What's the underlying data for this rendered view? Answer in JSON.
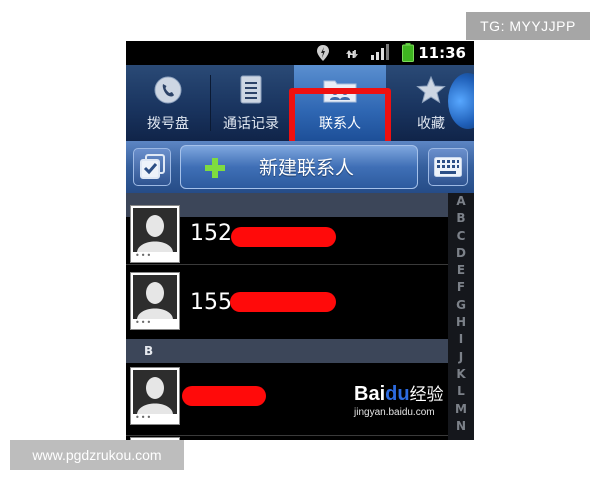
{
  "watermarks": {
    "top_right": "TG: MYYJJPP",
    "bottom_left": "www.pgdzrukou.com"
  },
  "status_bar": {
    "time": "11:36",
    "network_type": "H",
    "icons": [
      "gps-icon",
      "data-transfer-icon",
      "signal-strength-icon",
      "battery-icon"
    ]
  },
  "tabs": [
    {
      "label": "拨号盘",
      "icon": "phone-icon",
      "active": false
    },
    {
      "label": "通话记录",
      "icon": "call-log-icon",
      "active": false
    },
    {
      "label": "联系人",
      "icon": "contacts-folder-icon",
      "active": true
    },
    {
      "label": "收藏",
      "icon": "star-icon",
      "active": false
    }
  ],
  "highlight_color": "#ef1010",
  "action_bar": {
    "select_icon": "multi-select-checkbox-icon",
    "new_contact_label": "新建联系人",
    "plus_icon": "plus-icon",
    "keyboard_icon": "keyboard-icon"
  },
  "contacts": {
    "sections": [
      {
        "header": "",
        "items": [
          {
            "name_visible": "152",
            "redacted": true
          },
          {
            "name_visible": "155",
            "redacted": true
          }
        ]
      },
      {
        "header": "B",
        "items": [
          {
            "name_visible": "",
            "redacted": true
          }
        ]
      }
    ]
  },
  "alphabet_index": [
    "A",
    "B",
    "C",
    "D",
    "E",
    "F",
    "G",
    "H",
    "I",
    "J",
    "K",
    "L",
    "M",
    "N"
  ],
  "brand_watermark": {
    "logo_text_1": "Bai",
    "logo_text_2": "du",
    "logo_text_3": "经验",
    "url": "jingyan.baidu.com"
  }
}
